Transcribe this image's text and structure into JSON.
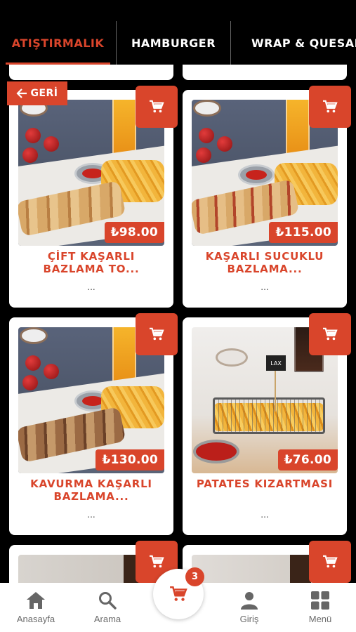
{
  "tabs": [
    {
      "label": "ATIŞTIRMALIK",
      "active": true
    },
    {
      "label": "HAMBURGER",
      "active": false
    },
    {
      "label": "WRAP & QUESADİLLA",
      "active": false
    }
  ],
  "back_button": {
    "label": "GERİ",
    "icon": "arrow-left-icon"
  },
  "products": [
    {
      "name": "ÇİFT KAŞARLI BAZLAMA TO...",
      "price": "₺98.00",
      "description": "..."
    },
    {
      "name": "KAŞARLI SUCUKLU BAZLAMA...",
      "price": "₺115.00",
      "description": "..."
    },
    {
      "name": "KAVURMA KAŞARLI BAZLAMA...",
      "price": "₺130.00",
      "description": "..."
    },
    {
      "name": "PATATES KIZARTMASI",
      "price": "₺76.00",
      "description": "..."
    }
  ],
  "top_partial_cards": [
    "...",
    "..."
  ],
  "cart": {
    "count": "3",
    "icon": "cart-icon"
  },
  "bottom_nav": [
    {
      "label": "Anasayfa",
      "icon": "home-icon"
    },
    {
      "label": "Arama",
      "icon": "search-icon"
    },
    {
      "label": "Giriş",
      "icon": "user-icon"
    },
    {
      "label": "Menü",
      "icon": "grid-menu-icon"
    }
  ],
  "colors": {
    "accent": "#d9452b",
    "background": "#000000",
    "card": "#ffffff"
  }
}
